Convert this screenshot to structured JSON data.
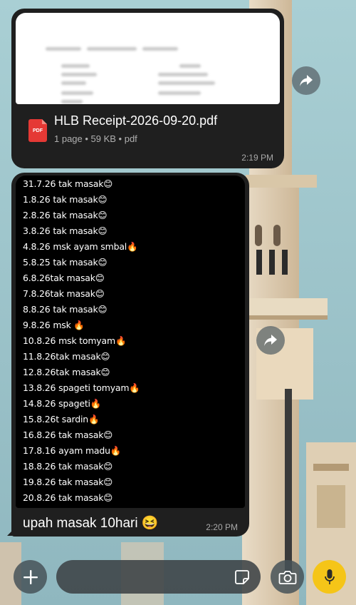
{
  "attachment": {
    "file_name": "HLB Receipt-2026-09-20.pdf",
    "file_meta": "1 page • 59 KB • pdf",
    "type_badge": "PDF",
    "time": "2:19 PM"
  },
  "note_message": {
    "lines": [
      "31.7.26 tak masak😊",
      "1.8.26 tak masak😊",
      "2.8.26 tak masak😊",
      "3.8.26 tak masak😊",
      "4.8.26 msk ayam smbal🔥",
      "5.8.25 tak masak😊",
      "6.8.26tak masak😊",
      "7.8.26tak masak😊",
      "8.8.26 tak masak😊",
      "9.8.26 msk 🔥",
      "10.8.26 msk tomyam🔥",
      "11.8.26tak masak😊",
      "12.8.26tak masak😊",
      "13.8.26 spageti tomyam🔥",
      "14.8.26 spageti🔥",
      "15.8.26t sardin🔥",
      "16.8.26 tak masak😊",
      "17.8.16 ayam madu🔥",
      "18.8.26 tak masak😊",
      "19.8.26 tak masak😊",
      "20.8.26 tak masak😊"
    ],
    "caption": "upah masak 10hari 😆",
    "time": "2:20 PM"
  },
  "icons": {
    "forward": "share-arrow-icon",
    "plus": "plus-icon",
    "sticker": "sticker-icon",
    "camera": "camera-icon",
    "mic": "microphone-icon",
    "pdf": "pdf-file-icon"
  },
  "colors": {
    "bubble": "#1f1f1f",
    "mic_button": "#f5c518",
    "pdf_badge": "#e53935"
  }
}
